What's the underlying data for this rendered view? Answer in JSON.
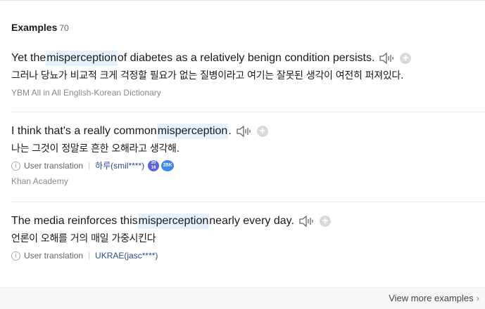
{
  "section": {
    "title": "Examples",
    "count": "70"
  },
  "examples": [
    {
      "pre": "Yet the ",
      "keyword": "misperception",
      "post": " of diabetes as a relatively benign condition persists.",
      "ko": "그러나 당뇨가 비교적 크게 걱정할 필요가 없는 질병이라고 여기는 잘못된 생각이 여전히 퍼져있다.",
      "source": "YBM All in All English-Korean Dictionary"
    },
    {
      "pre": "I think that's a really common ",
      "keyword": "misperception",
      "post": ".",
      "ko": "나는 그것이 정말로 흔한 오해라고 생각해.",
      "meta_label": "User translation",
      "user": "하루(smil****)",
      "badge1": "20\n16",
      "badge2": "35K",
      "source": "Khan Academy"
    },
    {
      "pre": "The media reinforces this ",
      "keyword": "misperception",
      "post": " nearly every day.",
      "ko": "언론이 오해를 거의 매일 가중시킨다",
      "meta_label": "User translation",
      "user": "UKRAE(jasc****)"
    }
  ],
  "footer": {
    "view_more": "View more examples"
  },
  "icons": {
    "speaker": "speaker-icon",
    "add": "plus-icon",
    "info": "info-icon",
    "chevron": "chevron-right-icon"
  }
}
